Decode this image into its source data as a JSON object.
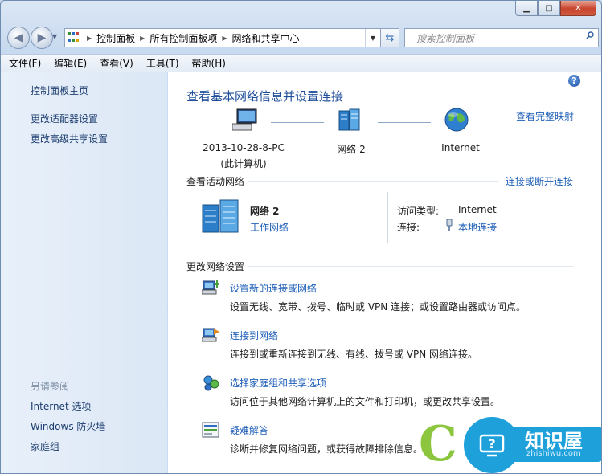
{
  "window": {
    "caption": {
      "minimize": "▁",
      "maximize": "□",
      "close": "✕"
    }
  },
  "address": {
    "crumbs": [
      "控制面板",
      "所有控制面板项",
      "网络和共享中心"
    ],
    "search_placeholder": "搜索控制面板"
  },
  "menu": [
    "文件(F)",
    "编辑(E)",
    "查看(V)",
    "工具(T)",
    "帮助(H)"
  ],
  "left_pane": {
    "links": [
      "控制面板主页",
      "更改适配器设置",
      "更改高级共享设置"
    ],
    "see_also_label": "另请参阅",
    "see_also": [
      "Internet 选项",
      "Windows 防火墙",
      "家庭组"
    ]
  },
  "main": {
    "title": "查看基本网络信息并设置连接",
    "full_map_link": "查看完整映射",
    "map": {
      "computer_line1": "2013-10-28-8-PC",
      "computer_line2": "(此计算机)",
      "network": "网络  2",
      "internet": "Internet"
    },
    "active": {
      "label": "查看活动网络",
      "connect_link": "连接或断开连接",
      "network_name": "网络  2",
      "network_type": "工作网络",
      "access_type_key": "访问类型:",
      "access_type_val": "Internet",
      "connection_key": "连接:",
      "connection_val": "本地连接"
    },
    "change": {
      "label": "更改网络设置",
      "tasks": [
        {
          "title": "设置新的连接或网络",
          "desc": "设置无线、宽带、拨号、临时或 VPN 连接；或设置路由器或访问点。"
        },
        {
          "title": "连接到网络",
          "desc": "连接到或重新连接到无线、有线、拨号或 VPN 网络连接。"
        },
        {
          "title": "选择家庭组和共享选项",
          "desc": "访问位于其他网络计算机上的文件和打印机，或更改共享设置。"
        },
        {
          "title": "疑难解答",
          "desc": "诊断并修复网络问题，或获得故障排除信息。"
        }
      ]
    }
  },
  "watermark": {
    "brand": "知识屋",
    "domain": "zhishiwu.com"
  },
  "colors": {
    "link": "#1f5fb8",
    "title": "#1f4e9a",
    "left_link": "#1e3e6f",
    "watermark_blue": "#1ea0db",
    "watermark_green": "#8bc63e"
  }
}
